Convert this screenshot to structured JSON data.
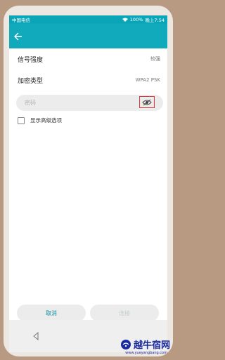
{
  "status_bar": {
    "carrier": "中国电信",
    "battery": "100%",
    "time": "晚上7:54"
  },
  "rows": [
    {
      "label": "信号强度",
      "value": "较强"
    },
    {
      "label": "加密类型",
      "value": "WPA2 PSK"
    }
  ],
  "password": {
    "placeholder": "密码",
    "value": ""
  },
  "advanced_option": {
    "label": "显示高级选项"
  },
  "buttons": {
    "cancel": "取消",
    "connect": "连接"
  },
  "watermark": {
    "text": "越牛宿网",
    "url": "www.yueyangbang.com"
  },
  "colors": {
    "accent": "#11aabd",
    "eye_highlight": "#e03b3b"
  },
  "icons": [
    "back-arrow-icon",
    "eye-icon",
    "nav-back-icon",
    "wifi-icon",
    "logo-icon"
  ]
}
